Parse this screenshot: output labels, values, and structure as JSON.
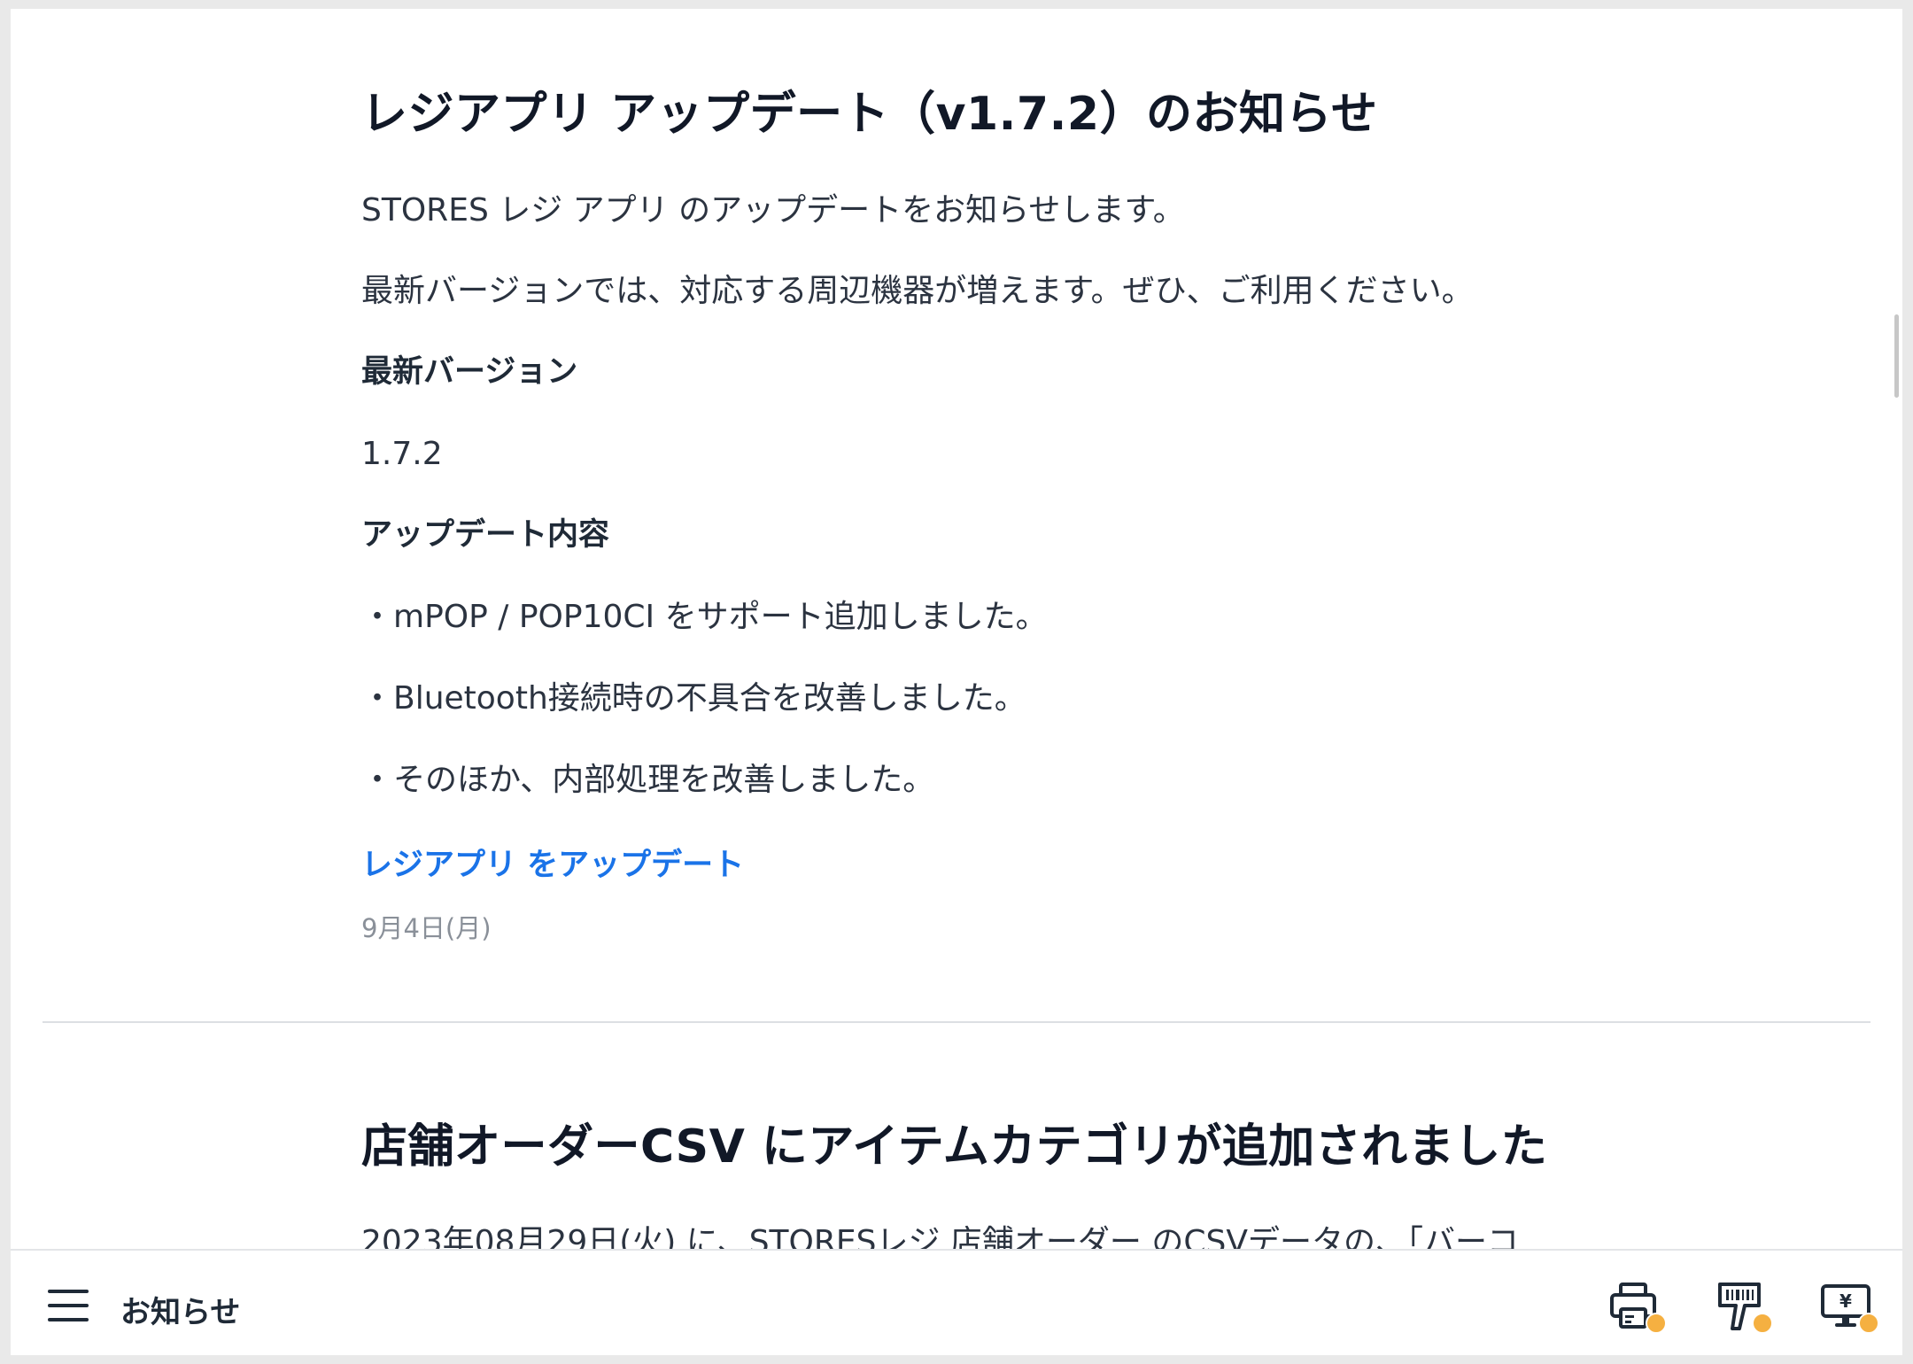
{
  "article1": {
    "title": "レジアプリ アップデート（v1.7.2）のお知らせ",
    "intro": "STORES レジ アプリ のアップデートをお知らせします。",
    "intro2": "最新バージョンでは、対応する周辺機器が増えます。ぜひ、ご利用ください。",
    "version_heading": "最新バージョン",
    "version": "1.7.2",
    "contents_heading": "アップデート内容",
    "items": [
      "・mPOP / POP10CI をサポート追加しました。",
      "・Bluetooth接続時の不具合を改善しました。",
      "・そのほか、内部処理を改善しました。"
    ],
    "link_label": "レジアプリ をアップデート",
    "date": "9月4日(月)"
  },
  "article2": {
    "title": "店舗オーダーCSV にアイテムカテゴリが追加されました",
    "intro": "2023年08月29日(火) に、STORESレジ 店舗オーダー のCSVデータの、「バーコ"
  },
  "bottom_bar": {
    "title": "お知らせ",
    "devices": [
      {
        "icon": "printer-icon",
        "status_color": "#f5b041"
      },
      {
        "icon": "barcode-scanner-icon",
        "status_color": "#f5b041"
      },
      {
        "icon": "customer-display-icon",
        "status_color": "#f5b041"
      }
    ]
  },
  "colors": {
    "link": "#1a73e8",
    "status_warning": "#f5b041"
  }
}
